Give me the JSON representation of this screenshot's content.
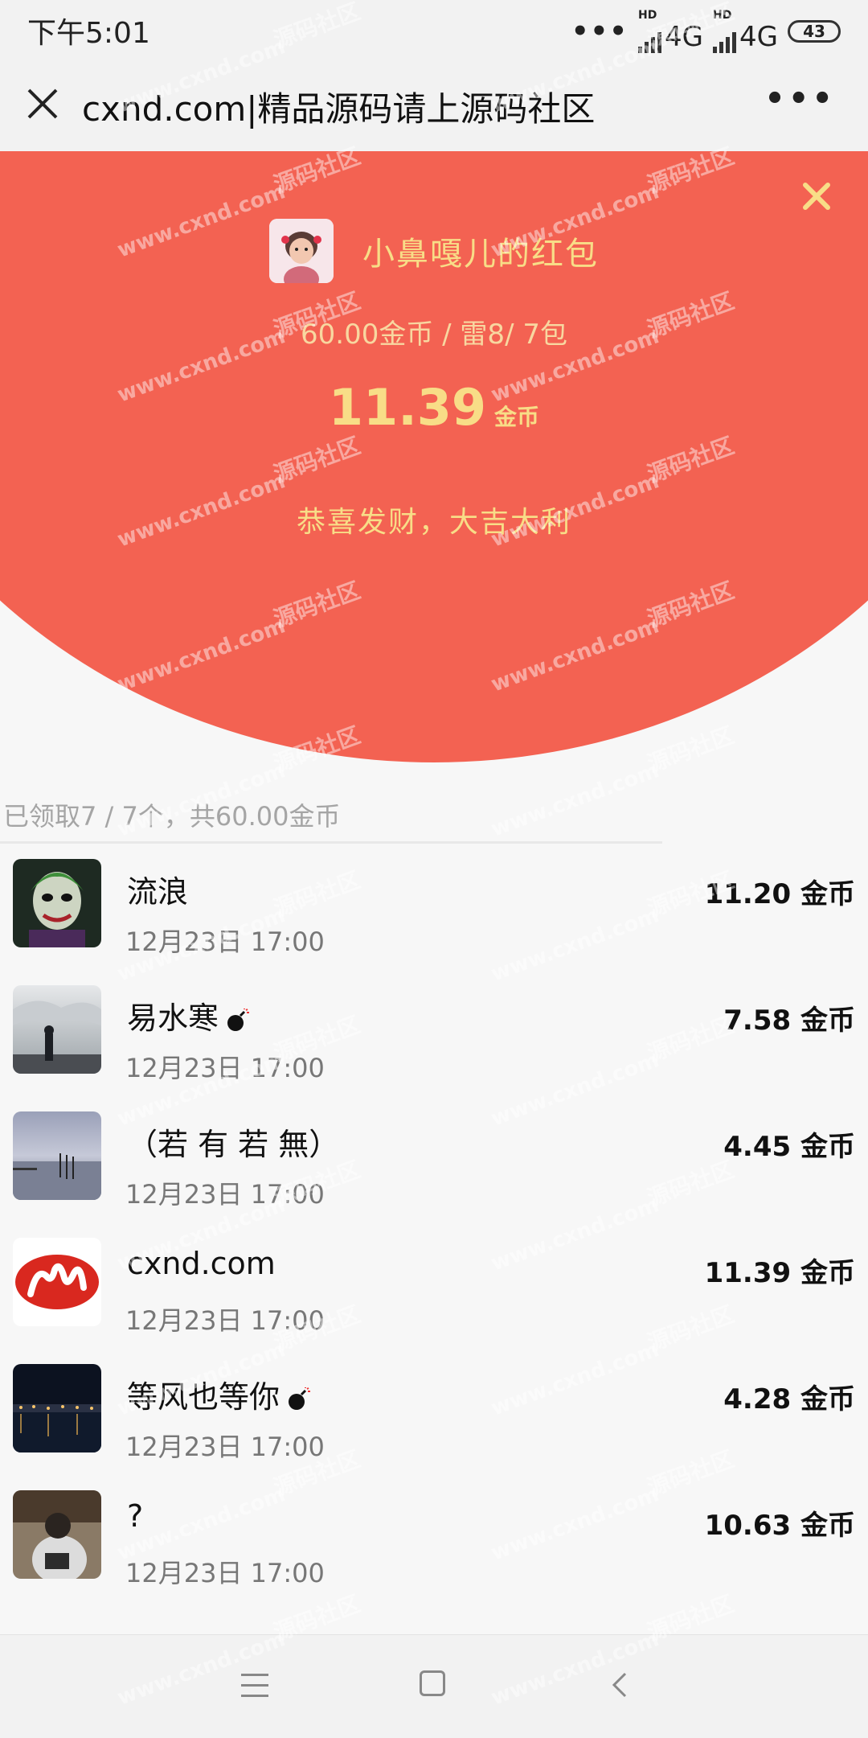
{
  "status_bar": {
    "time": "下午5:01",
    "dots": "•••",
    "signal1_badge": "HD",
    "signal1_label": "4G",
    "signal2_badge": "HD",
    "signal2_label": "4G",
    "battery": "43"
  },
  "title_bar": {
    "title": "cxnd.com|精品源码请上源码社区",
    "close_icon": "close-icon",
    "more_icon": "more-icon"
  },
  "packet": {
    "sender_name": "小鼻嘎儿的红包",
    "info": "60.00金币 / 雷8/ 7包",
    "amount": "11.39",
    "amount_unit": "金币",
    "blessing": "恭喜发财，大吉大利",
    "header_color": "#f36252",
    "accent_color": "#f8dd87"
  },
  "summary": "已领取7 / 7个，共60.00金币",
  "records": [
    {
      "name": "流浪",
      "time": "12月23日  17:00",
      "amount": "11.20 金币",
      "bomb": false
    },
    {
      "name": "易水寒",
      "time": "12月23日  17:00",
      "amount": "7.58 金币",
      "bomb": true
    },
    {
      "name": "（若 有 若 無）",
      "time": "12月23日  17:00",
      "amount": "4.45 金币",
      "bomb": false
    },
    {
      "name": "cxnd.com",
      "time": "12月23日  17:00",
      "amount": "11.39 金币",
      "bomb": false
    },
    {
      "name": "等风也等你",
      "time": "12月23日  17:00",
      "amount": "4.28 金币",
      "bomb": true
    },
    {
      "name": "?",
      "time": "12月23日  17:00",
      "amount": "10.63 金币",
      "bomb": false
    }
  ],
  "watermark": {
    "domain": "www.cxnd.com",
    "brand": "源码社区"
  }
}
